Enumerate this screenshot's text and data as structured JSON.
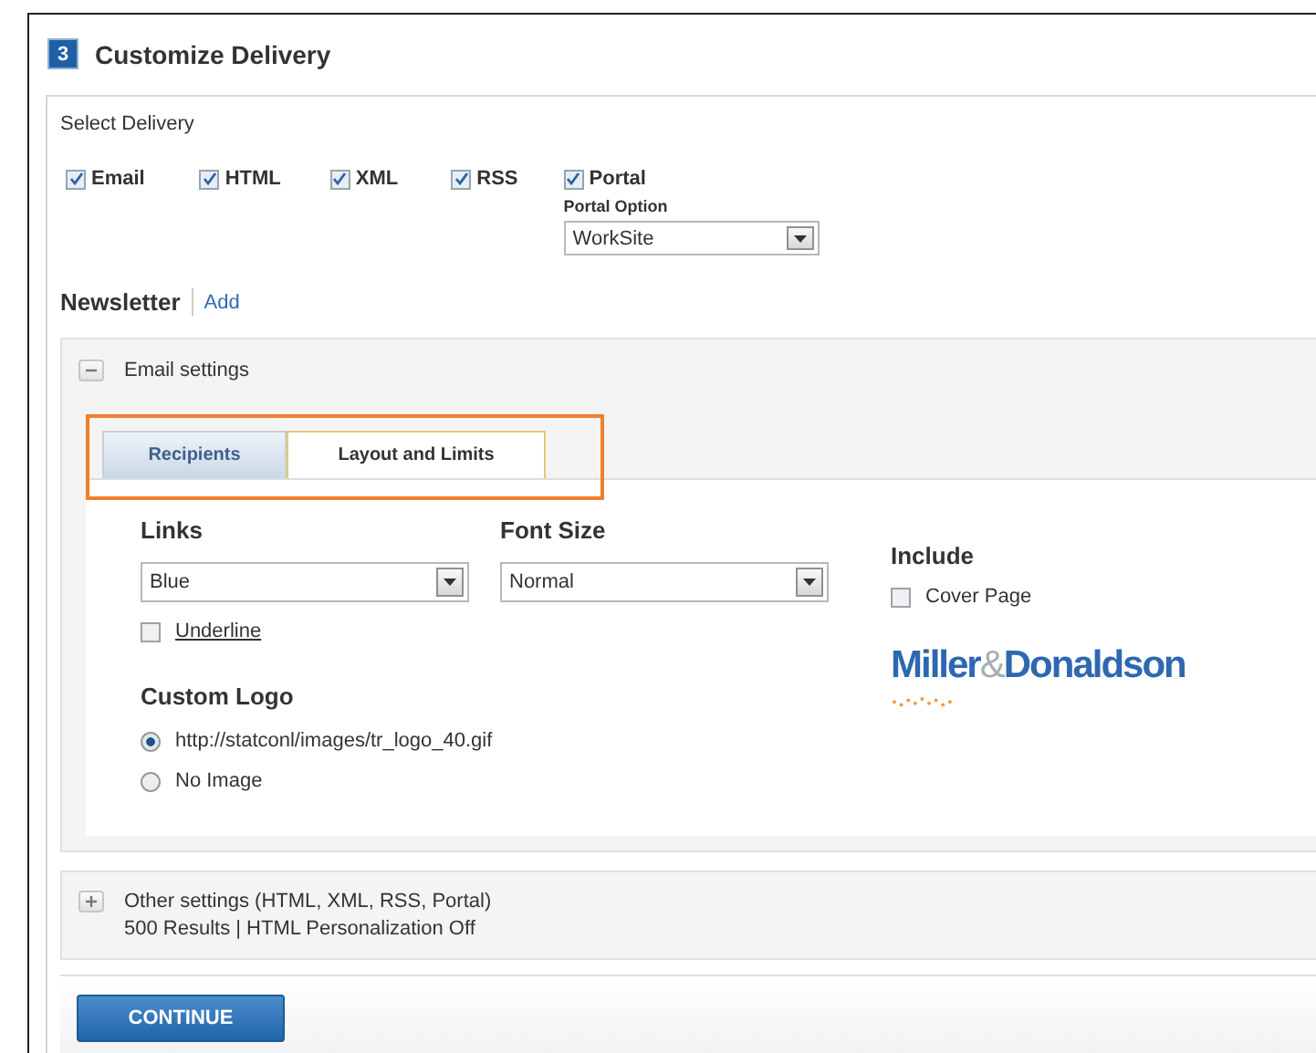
{
  "step": {
    "number": "3",
    "title": "Customize Delivery"
  },
  "select_delivery": {
    "label": "Select Delivery",
    "options": [
      {
        "label": "Email",
        "checked": true
      },
      {
        "label": "HTML",
        "checked": true
      },
      {
        "label": "XML",
        "checked": true
      },
      {
        "label": "RSS",
        "checked": true
      },
      {
        "label": "Portal",
        "checked": true
      }
    ],
    "portal_option": {
      "label": "Portal Option",
      "value": "WorkSite"
    }
  },
  "newsletter": {
    "title": "Newsletter",
    "add_link": "Add"
  },
  "email_settings": {
    "title": "Email settings",
    "expanded": true,
    "tabs": [
      {
        "label": "Recipients",
        "selected": false
      },
      {
        "label": "Layout and Limits",
        "selected": true
      }
    ],
    "links": {
      "label": "Links",
      "value": "Blue",
      "underline": {
        "label": "Underline",
        "checked": false
      }
    },
    "font_size": {
      "label": "Font Size",
      "value": "Normal"
    },
    "custom_logo": {
      "label": "Custom Logo",
      "options": [
        {
          "label": "http://statconl/images/tr_logo_40.gif",
          "selected": true
        },
        {
          "label": "No Image",
          "selected": false
        }
      ]
    },
    "include": {
      "label": "Include",
      "cover_page": {
        "label": "Cover Page",
        "checked": false
      }
    },
    "logo": {
      "first": "Miller",
      "ampersand": "&",
      "second": "Donaldson"
    }
  },
  "other_settings": {
    "title": "Other settings (HTML, XML, RSS, Portal)",
    "summary": "500 Results | HTML Personalization Off",
    "expanded": false
  },
  "continue_button": "CONTINUE"
}
